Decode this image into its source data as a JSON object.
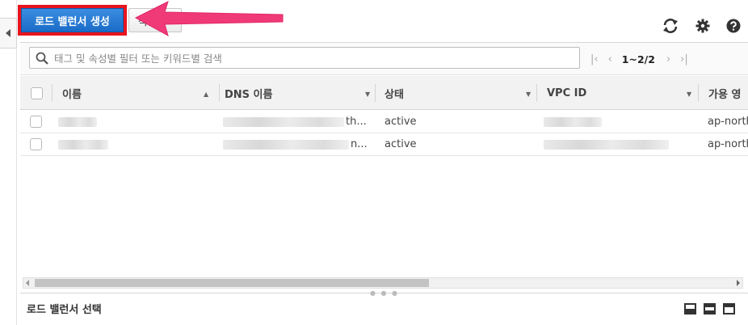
{
  "toolbar": {
    "create_label": "로드 밸런서 생성",
    "actions_label": "작"
  },
  "icons": {
    "refresh": "refresh-icon",
    "settings": "gear-icon",
    "help": "help-icon",
    "search": "search-icon"
  },
  "search": {
    "placeholder": "태그 및 속성별 필터 또는 키워드별 검색"
  },
  "pager": {
    "count": "1~2/2"
  },
  "table": {
    "columns": [
      "이름",
      "DNS 이름",
      "상태",
      "VPC ID",
      "가용 영"
    ],
    "rows": [
      {
        "dns_suffix": "th...",
        "state": "active",
        "az": "ap-northeast"
      },
      {
        "dns_suffix": "n...",
        "state": "active",
        "az": "ap-northeast"
      }
    ]
  },
  "footer": {
    "title": "로드 밸런서 선택"
  },
  "colors": {
    "primary_button": "#1b6cc8",
    "highlight_border": "#e8141e",
    "arrow": "#f03a78"
  }
}
